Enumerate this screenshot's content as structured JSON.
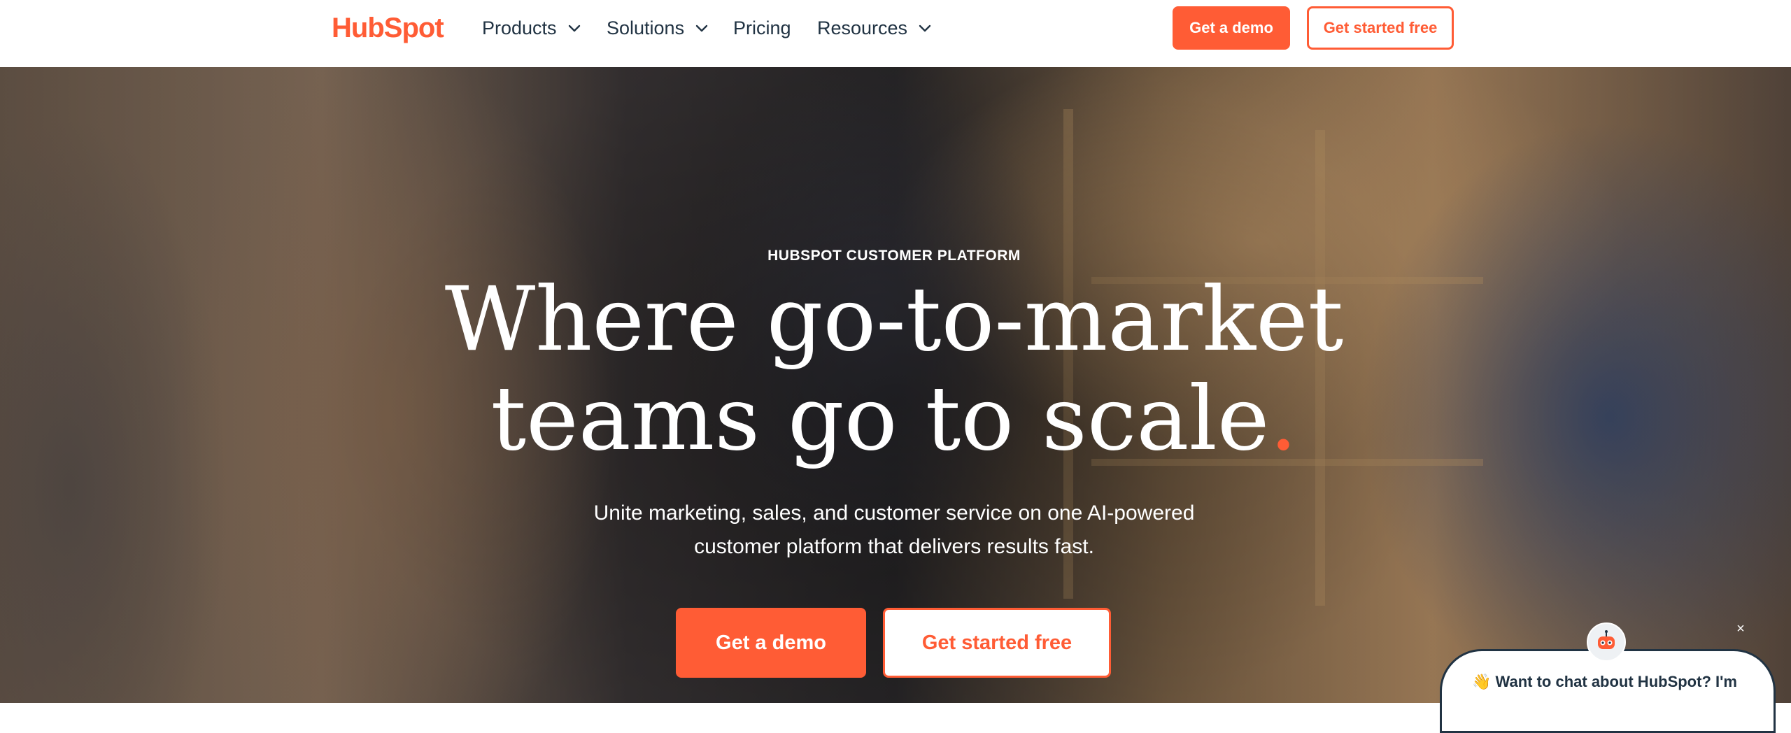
{
  "nav": {
    "logo_text_1": "Hub",
    "logo_text_2": "Spot",
    "items": [
      {
        "label": "Products",
        "has_dropdown": true
      },
      {
        "label": "Solutions",
        "has_dropdown": true
      },
      {
        "label": "Pricing",
        "has_dropdown": false
      },
      {
        "label": "Resources",
        "has_dropdown": true
      }
    ],
    "demo_button": "Get a demo",
    "free_button": "Get started free"
  },
  "hero": {
    "eyebrow": "HUBSPOT CUSTOMER PLATFORM",
    "headline_line1": "Where go-to-market",
    "headline_line2": "teams go to scale",
    "headline_dot": ".",
    "subtext_line1": "Unite marketing, sales, and customer service on one AI-powered",
    "subtext_line2": "customer platform that delivers results fast.",
    "demo_button": "Get a demo",
    "free_button": "Get started free"
  },
  "chat": {
    "close_glyph": "×",
    "wave_emoji": "👋",
    "message_line1": "Want to chat about HubSpot? I'm"
  },
  "colors": {
    "brand_orange": "#ff5c35",
    "dark_navy": "#213343",
    "white": "#ffffff"
  }
}
